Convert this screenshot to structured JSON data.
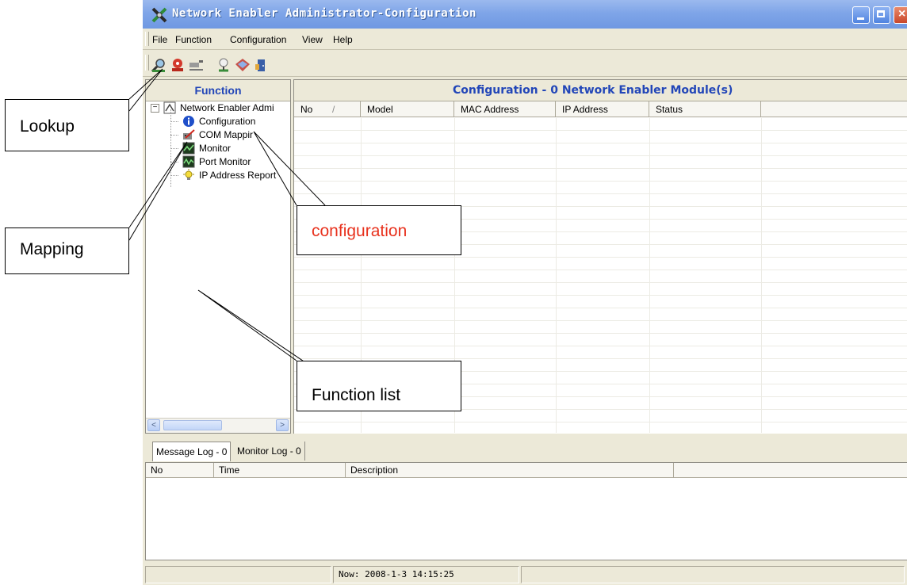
{
  "window": {
    "title": "Network Enabler Administrator-Configuration"
  },
  "menu": [
    {
      "label": "File"
    },
    {
      "label": "Function"
    },
    {
      "label": "Configuration"
    },
    {
      "label": "View"
    },
    {
      "label": "Help"
    }
  ],
  "toolbar": {
    "icons": [
      "search-icon",
      "broadcast-search-icon",
      "com-mapping-icon",
      "assign-icon",
      "diskette-icon",
      "exit-icon"
    ]
  },
  "function_pane": {
    "title": "Function",
    "tree": {
      "root": "Network Enabler Admi",
      "items": [
        {
          "label": "Configuration",
          "icon": "info-icon"
        },
        {
          "label": "COM Mappir",
          "icon": "com-mapping-icon"
        },
        {
          "label": "Monitor",
          "icon": "monitor-icon"
        },
        {
          "label": "Port Monitor",
          "icon": "port-monitor-icon"
        },
        {
          "label": "IP Address Report",
          "icon": "bulb-icon"
        }
      ]
    }
  },
  "config_pane": {
    "title": "Configuration - 0 Network Enabler Module(s)",
    "columns": [
      "No",
      "Model",
      "MAC Address",
      "IP Address",
      "Status"
    ],
    "sort_indicator": "/"
  },
  "log": {
    "tabs": [
      "Message Log - 0",
      "Monitor Log - 0"
    ],
    "columns": [
      "No",
      "Time",
      "Description"
    ]
  },
  "status": {
    "now": "Now: 2008-1-3 14:15:25"
  },
  "callouts": {
    "lookup": "Lookup",
    "mapping": "Mapping",
    "configuration": "configuration",
    "function_list": "Function list"
  },
  "colors": {
    "title_blue": "#2246b8",
    "callout_red": "#e8321e"
  }
}
